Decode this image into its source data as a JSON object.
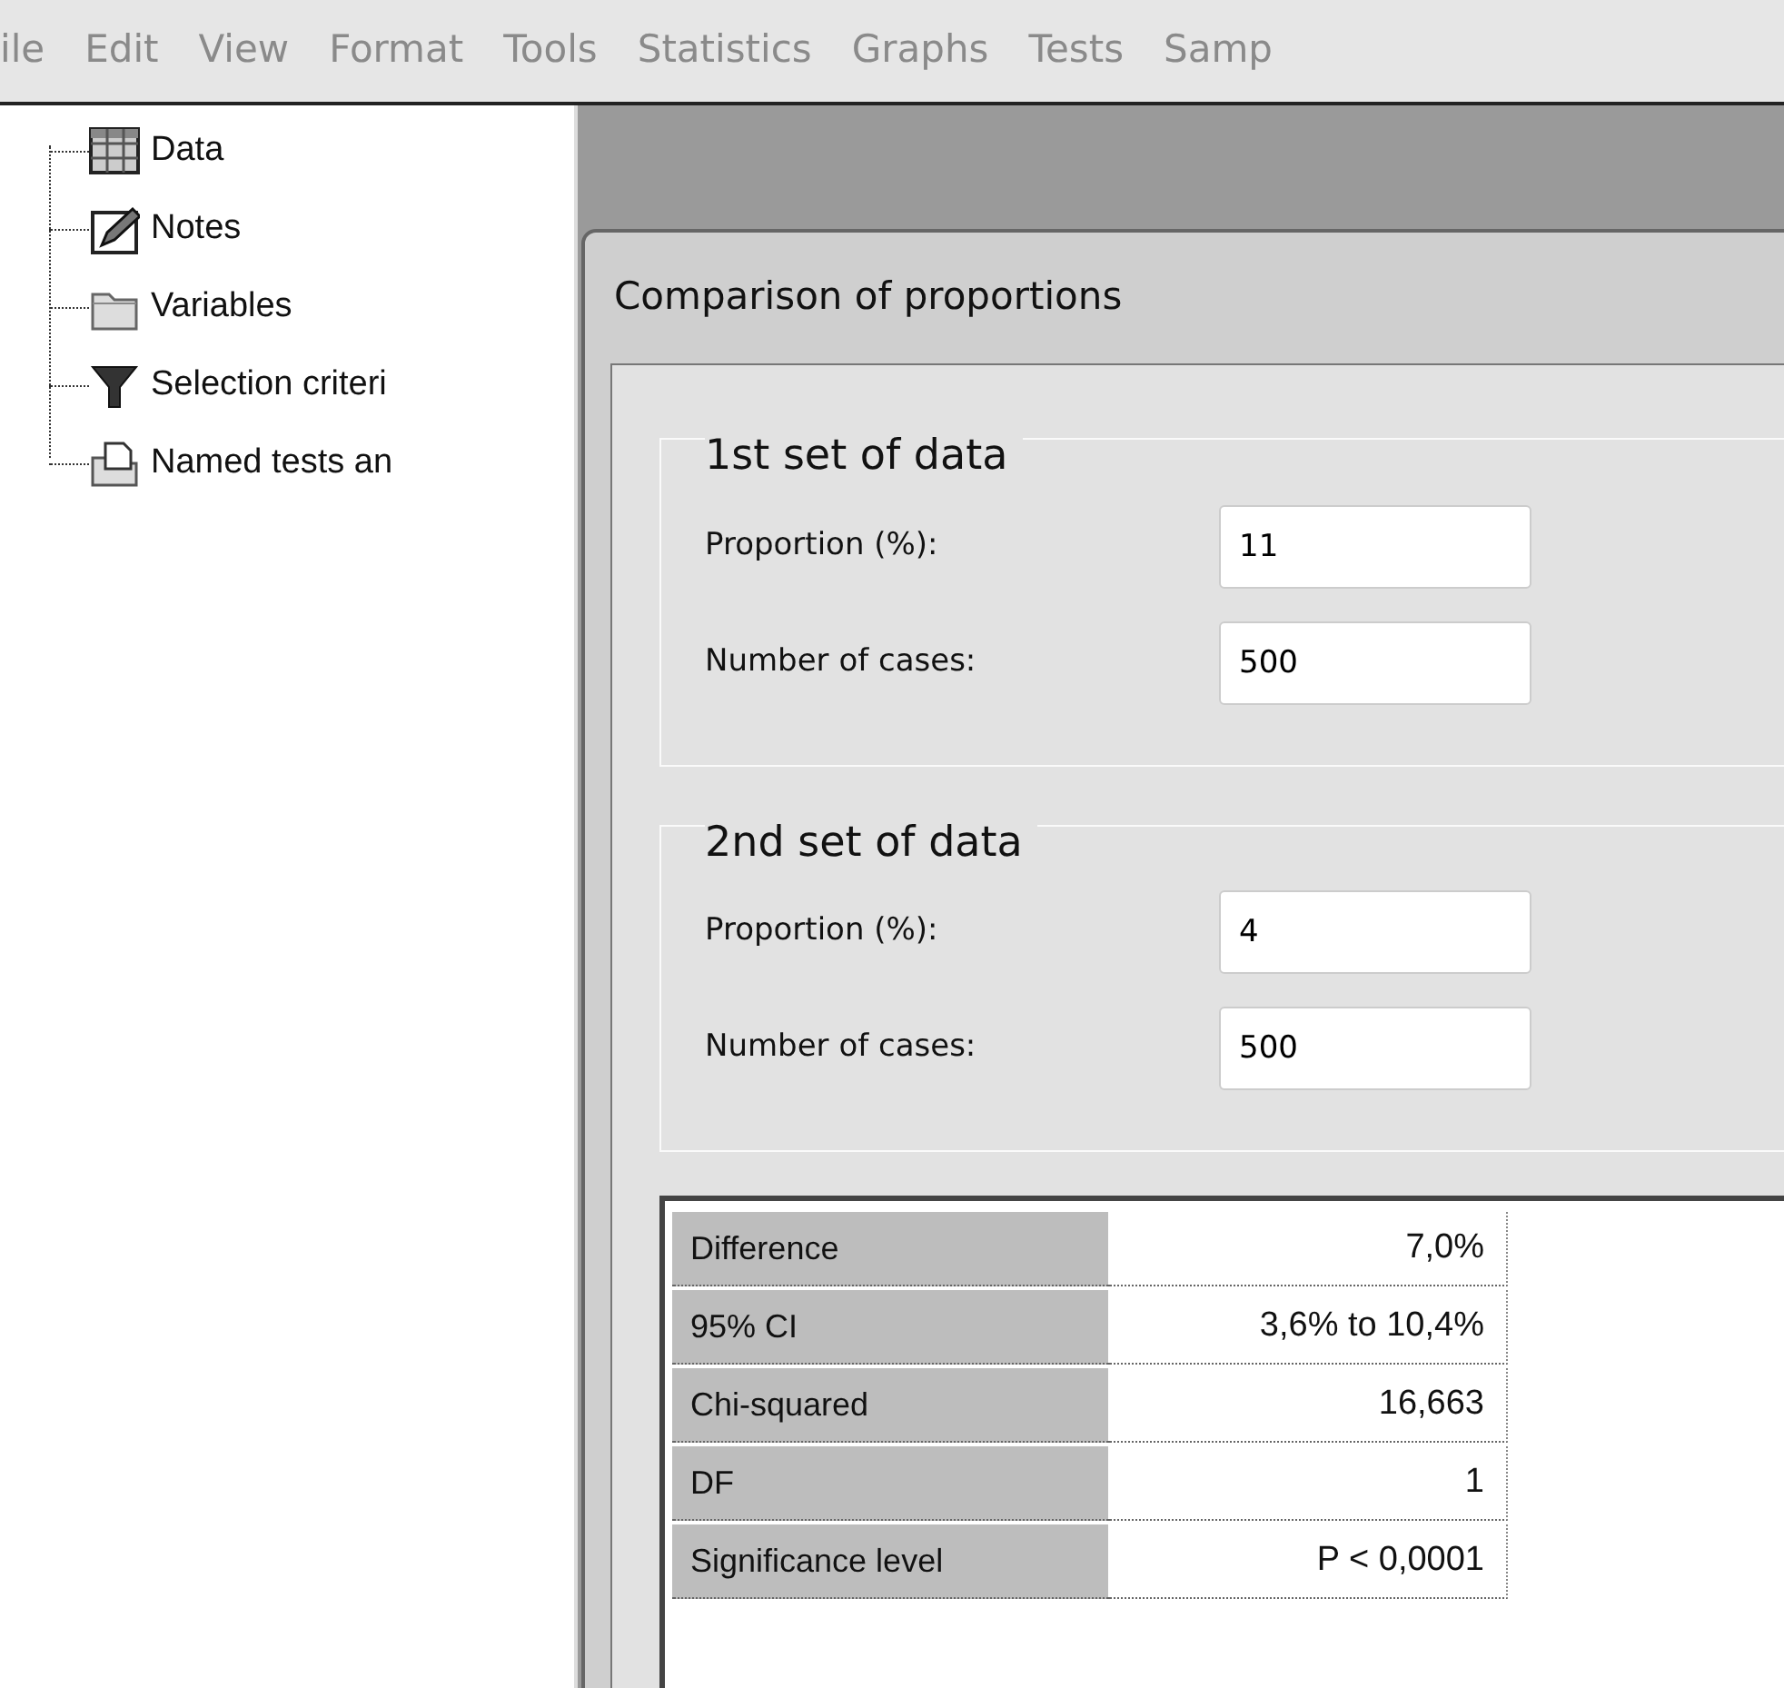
{
  "menu": [
    "ile",
    "Edit",
    "View",
    "Format",
    "Tools",
    "Statistics",
    "Graphs",
    "Tests",
    "Samp"
  ],
  "tree": {
    "items": [
      {
        "label": "Data",
        "kind": "grid"
      },
      {
        "label": "Notes",
        "kind": "notes"
      },
      {
        "label": "Variables",
        "kind": "folder"
      },
      {
        "label": "Selection criteri",
        "kind": "filter"
      },
      {
        "label": "Named tests an",
        "kind": "tests"
      }
    ]
  },
  "dialog": {
    "title": "Comparison of proportions",
    "groups": [
      {
        "legend": "1st set of data",
        "fields": [
          {
            "label": "Proportion (%):",
            "value": "11"
          },
          {
            "label": "Number of cases:",
            "value": "500"
          }
        ]
      },
      {
        "legend": "2nd set of data",
        "fields": [
          {
            "label": "Proportion (%):",
            "value": "4"
          },
          {
            "label": "Number of cases:",
            "value": "500"
          }
        ]
      }
    ],
    "results": [
      {
        "label": "Difference",
        "value": "7,0%"
      },
      {
        "label": "95% CI",
        "value": "3,6% to 10,4%"
      },
      {
        "label": "Chi-squared",
        "value": "16,663"
      },
      {
        "label": "DF",
        "value": "1"
      },
      {
        "label": "Significance level",
        "value": "P < 0,0001"
      }
    ]
  }
}
